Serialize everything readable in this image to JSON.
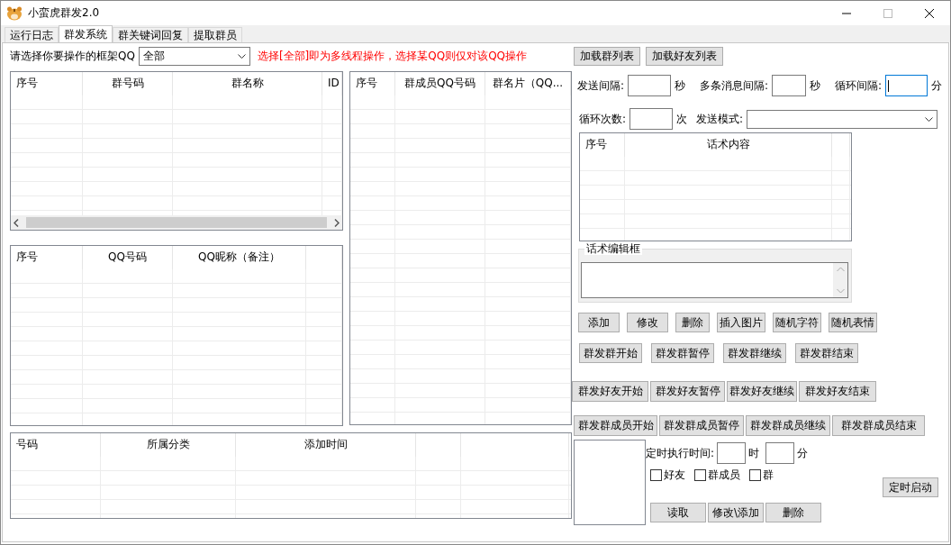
{
  "window": {
    "title": "小蛮虎群发2.0"
  },
  "tabs": [
    {
      "label": "运行日志",
      "selected": false
    },
    {
      "label": "群发系统",
      "selected": true
    },
    {
      "label": "群关键词回复",
      "selected": false
    },
    {
      "label": "提取群员",
      "selected": false
    }
  ],
  "account": {
    "label": "请选择你要操作的框架QQ",
    "value": "全部",
    "hint": "选择[全部]即为多线程操作，选择某QQ则仅对该QQ操作"
  },
  "load_buttons": [
    "加载群列表",
    "加载好友列表"
  ],
  "group_table": {
    "columns": [
      "序号",
      "群号码",
      "群名称",
      "ID"
    ]
  },
  "friend_table": {
    "columns": [
      "序号",
      "QQ号码",
      "QQ昵称（备注）"
    ]
  },
  "member_table": {
    "columns": [
      "序号",
      "群成员QQ号码",
      "群名片（QQ..."
    ]
  },
  "record_table": {
    "columns": [
      "号码",
      "所属分类",
      "添加时间"
    ]
  },
  "interval_fields": [
    {
      "label": "发送间隔:",
      "unit": "秒",
      "focused": false
    },
    {
      "label": "多条消息间隔:",
      "unit": "秒",
      "focused": false
    },
    {
      "label": "循环间隔:",
      "unit": "分",
      "focused": true
    }
  ],
  "loop_field": {
    "label": "循环次数:",
    "unit": "次",
    "focused": false
  },
  "send_mode": {
    "label": "发送模式:"
  },
  "script_table": {
    "columns": [
      "序号",
      "话术内容"
    ]
  },
  "editor": {
    "legend": "话术编辑框"
  },
  "edit_buttons": [
    "添加",
    "修改",
    "删除",
    "插入图片",
    "随机字符",
    "随机表情"
  ],
  "group_buttons": [
    "群发群开始",
    "群发群暂停",
    "群发群继续",
    "群发群结束"
  ],
  "friend_buttons": [
    "群发好友开始",
    "群发好友暂停",
    "群发好友继续",
    "群发好友结束"
  ],
  "member_buttons": [
    "群发群成员开始",
    "群发群成员暂停",
    "群发群成员继续",
    "群发群成员结束"
  ],
  "timer": {
    "label": "定时执行时间:",
    "hour_unit": "时",
    "minute_unit": "分",
    "checkboxes": [
      {
        "label": "好友",
        "checked": false
      },
      {
        "label": "群成员",
        "checked": false
      },
      {
        "label": "群",
        "checked": false
      }
    ],
    "start_button": "定时启动",
    "buttons": [
      "读取",
      "修改\\添加",
      "删除"
    ]
  }
}
